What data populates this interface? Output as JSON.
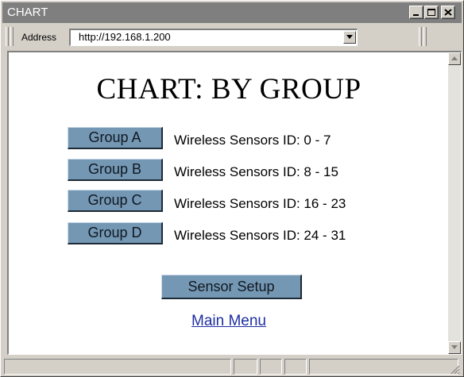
{
  "window": {
    "title": "CHART"
  },
  "addressbar": {
    "label": "Address",
    "url": "http://192.168.1.200"
  },
  "page": {
    "title": "CHART: BY GROUP",
    "groups": [
      {
        "label": "Group A",
        "desc": "Wireless Sensors ID:  0 - 7"
      },
      {
        "label": "Group B",
        "desc": "Wireless Sensors ID:  8 - 15"
      },
      {
        "label": "Group C",
        "desc": "Wireless Sensors ID:  16 - 23"
      },
      {
        "label": "Group D",
        "desc": "Wireless Sensors ID:  24 - 31"
      }
    ],
    "setup_button": "Sensor Setup",
    "main_menu_link": "Main Menu"
  },
  "colors": {
    "button_fill": "#7497b4",
    "titlebar": "#7f7f7f",
    "link": "#1e2ea0"
  },
  "icons": [
    "minimize-icon",
    "maximize-icon",
    "close-icon",
    "dropdown-arrow-icon",
    "scroll-up-icon",
    "scroll-down-icon",
    "resize-grip-icon"
  ]
}
